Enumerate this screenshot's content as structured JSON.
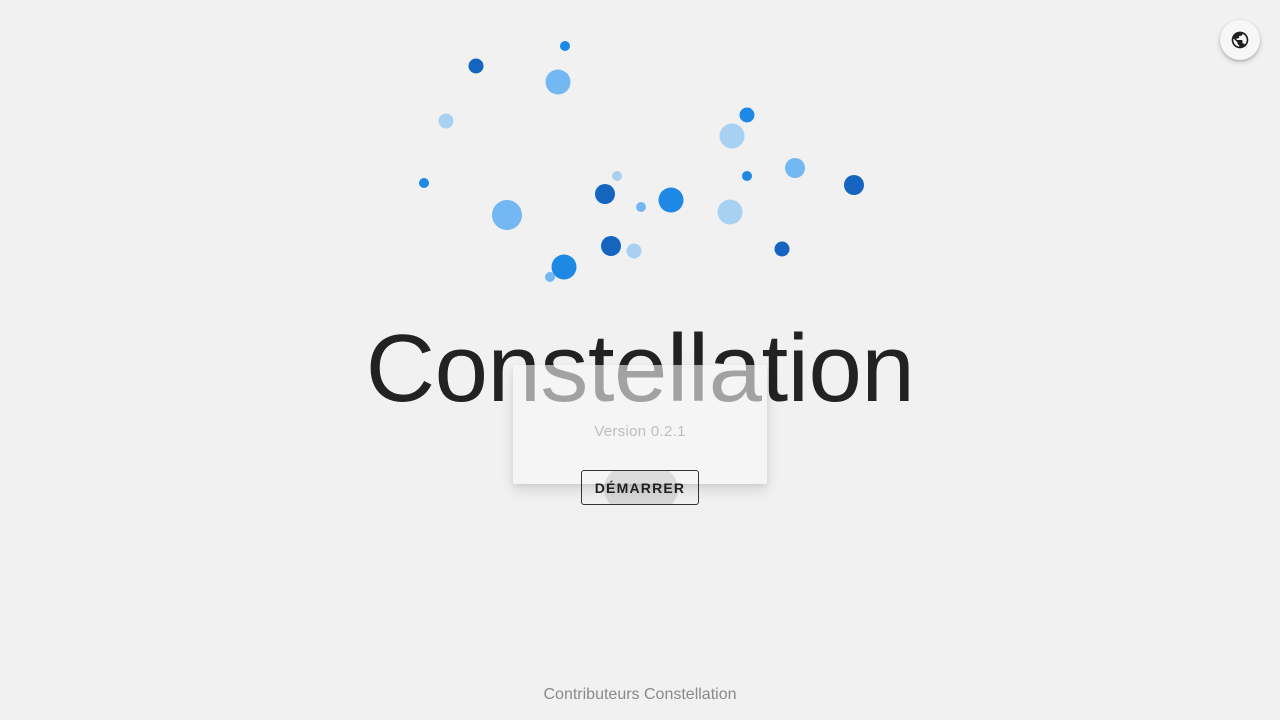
{
  "header": {
    "language_icon": "globe-icon"
  },
  "app": {
    "title": "Constellation",
    "version": "Version 0.2.1",
    "start_label": "DÉMARRER"
  },
  "footer": {
    "credits": "Contributeurs Constellation"
  },
  "colors": {
    "background": "#f1f1f1",
    "dot_dark": "#1565c0",
    "dot_medium": "#1e88e5",
    "dot_light": "#64b5f6",
    "dot_pale": "#a8d1f1"
  }
}
